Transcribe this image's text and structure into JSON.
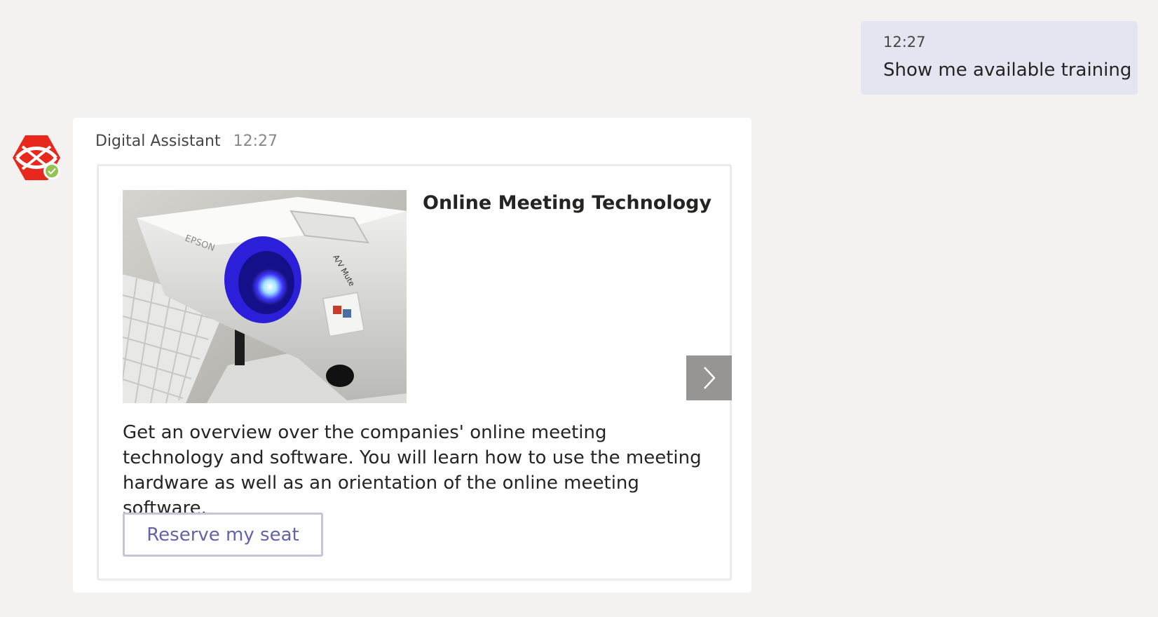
{
  "user_message": {
    "time": "12:27",
    "text": "Show me available training"
  },
  "bot_message": {
    "sender": "Digital Assistant",
    "time": "12:27",
    "avatar_icon": "digital-assistant-logo-icon",
    "status_icon": "available-check-icon",
    "card": {
      "image_icon": "projector-photo",
      "title": "Online Meeting Technology",
      "description": "Get an overview over the companies' online meeting technology and software. You will learn how to use the meeting hardware as well as an orientation of the online meeting software.",
      "action_label": "Reserve my seat",
      "next_icon": "chevron-right-icon"
    }
  },
  "colors": {
    "background": "#f3f2f1",
    "user_bubble": "#e5e5f1",
    "accent": "#6264a7",
    "button_border": "#c5c3de",
    "status_green": "#92c353",
    "avatar_red": "#e8271d",
    "carousel_button": "#979593"
  }
}
